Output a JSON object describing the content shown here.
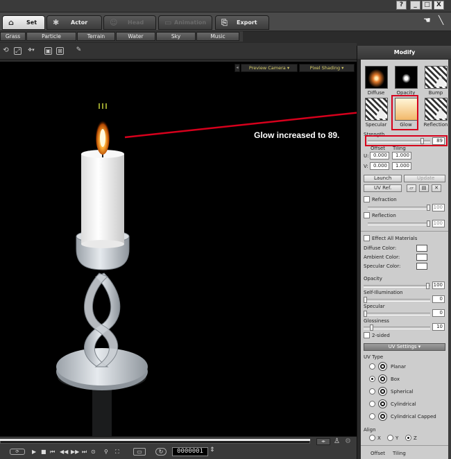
{
  "window": {
    "help_icon": "?",
    "min_icon": "_",
    "max_icon": "□",
    "close_icon": "X"
  },
  "main_tabs": [
    {
      "label": "Set",
      "icon": "set-icon",
      "state": "active"
    },
    {
      "label": "Actor",
      "icon": "actor-icon",
      "state": "normal"
    },
    {
      "label": "Head",
      "icon": "head-icon",
      "state": "disabled"
    },
    {
      "label": "Animation",
      "icon": "animation-icon",
      "state": "disabled"
    },
    {
      "label": "Export",
      "icon": "export-icon",
      "state": "normal"
    }
  ],
  "sub_tabs": [
    "Grass",
    "Particle",
    "Terrain",
    "Water",
    "Sky",
    "Music"
  ],
  "viewport": {
    "camera": "Preview Camera",
    "shading": "Pixel Shading"
  },
  "annotation": {
    "text": "Glow increased to 89.",
    "arrow_color": "#d6001c"
  },
  "panel": {
    "title": "Modify",
    "material_channels": [
      {
        "label": "Diffuse"
      },
      {
        "label": "Opacity"
      },
      {
        "label": "Bump"
      },
      {
        "label": "Specular"
      },
      {
        "label": "Glow"
      },
      {
        "label": "Reflection"
      }
    ],
    "strength": {
      "label": "Strength",
      "value": "89",
      "fraction": 0.89
    },
    "offset_label": "Offset",
    "tiling_label": "Tiling",
    "u_label": "U:",
    "v_label": "V:",
    "u_offset": "0.000",
    "u_tiling": "1.000",
    "v_offset": "0.000",
    "v_tiling": "1.000",
    "launch_label": "Launch",
    "update_label": "Update",
    "uvref_label": "UV Ref.",
    "refraction": {
      "label": "Refraction",
      "value": "100"
    },
    "reflection": {
      "label": "Reflection",
      "value": "100"
    },
    "effect_all": "Effect All Materials",
    "diffuse_color": "Diffuse Color:",
    "ambient_color": "Ambient Color:",
    "specular_color": "Specular Color:",
    "opacity": {
      "label": "Opacity",
      "value": "100"
    },
    "self_illum": {
      "label": "Self-Illumination",
      "value": "0"
    },
    "specular": {
      "label": "Specular",
      "value": "0"
    },
    "glossiness": {
      "label": "Glossiness",
      "value": "10"
    },
    "two_sided": "2-sided",
    "uv_settings": "UV Settings",
    "uv_type": "UV Type",
    "uv_options": [
      {
        "label": "Planar",
        "selected": false
      },
      {
        "label": "Box",
        "selected": true
      },
      {
        "label": "Spherical",
        "selected": false
      },
      {
        "label": "Cylindrical",
        "selected": false
      },
      {
        "label": "Cylindrical Capped",
        "selected": false
      }
    ],
    "align_label": "Align",
    "align_options": [
      {
        "label": "X",
        "selected": false
      },
      {
        "label": "Y",
        "selected": false
      },
      {
        "label": "Z",
        "selected": true
      }
    ],
    "bottom_offset": "Offset",
    "bottom_tiling": "Tiling"
  },
  "playback": {
    "timecode": "0000001"
  }
}
